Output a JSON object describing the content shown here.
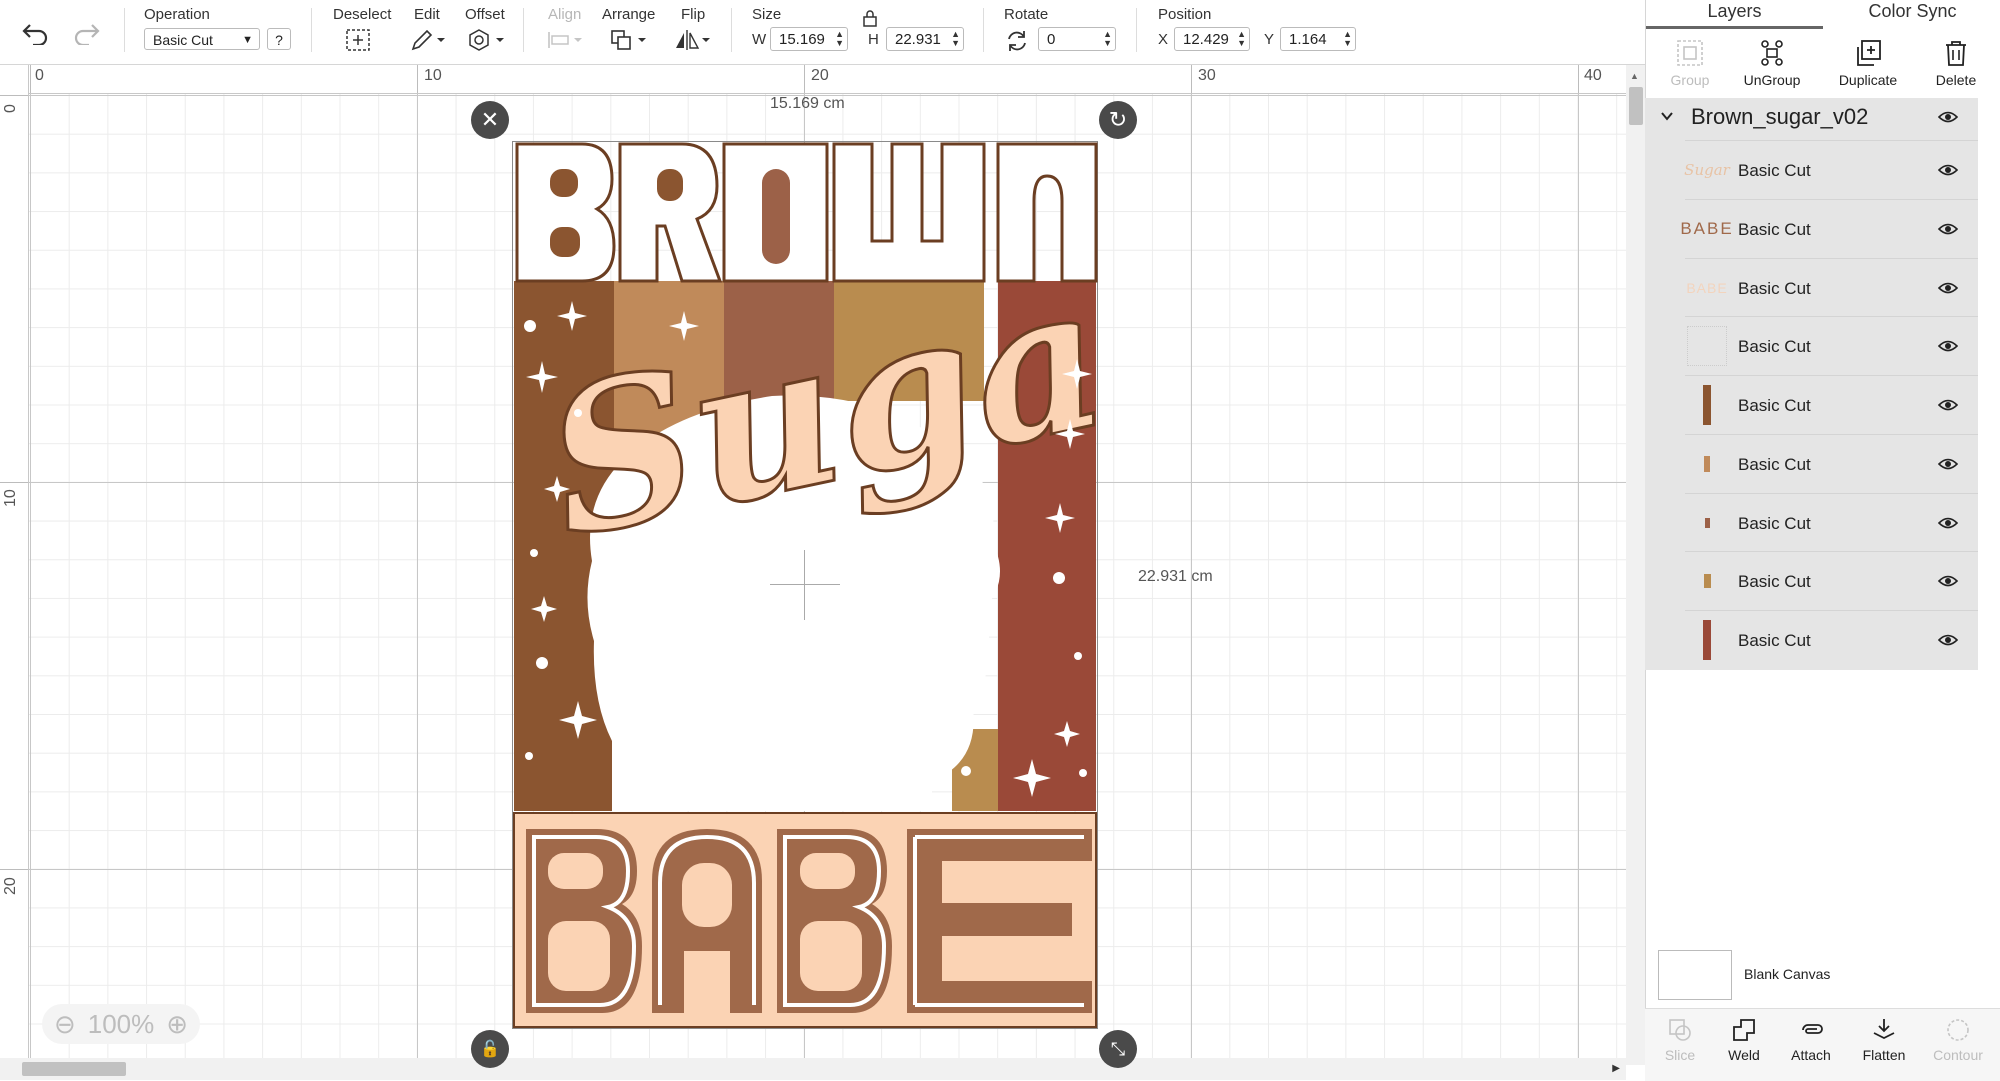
{
  "toolbar": {
    "operation": {
      "label": "Operation",
      "value": "Basic Cut",
      "help": "?"
    },
    "deselect": {
      "label": "Deselect"
    },
    "edit": {
      "label": "Edit"
    },
    "offset": {
      "label": "Offset"
    },
    "align": {
      "label": "Align"
    },
    "arrange": {
      "label": "Arrange"
    },
    "flip": {
      "label": "Flip"
    },
    "size": {
      "label": "Size",
      "w_label": "W",
      "w_value": "15.169",
      "h_label": "H",
      "h_value": "22.931"
    },
    "rotate": {
      "label": "Rotate",
      "value": "0"
    },
    "position": {
      "label": "Position",
      "x_label": "X",
      "x_value": "12.429",
      "y_label": "Y",
      "y_value": "1.164"
    }
  },
  "ruler": {
    "top": [
      "0",
      "10",
      "20",
      "30",
      "40"
    ],
    "left": [
      "0",
      "10",
      "20"
    ]
  },
  "canvas": {
    "width_label": "15.169 cm",
    "height_label": "22.931 cm",
    "zoom": "100%"
  },
  "design": {
    "word_top": "BROWN",
    "word_middle": "Sugar",
    "word_bottom": "BABE",
    "colors": {
      "dark_brown": "#8b5530",
      "caramel": "#c08a5a",
      "mocha": "#9c6148",
      "gold": "#b98c4f",
      "rust": "#9a4938",
      "peach": "#fbd3b4",
      "mid_brown": "#a0694a"
    }
  },
  "panel": {
    "tabs": [
      "Layers",
      "Color Sync"
    ],
    "actions": [
      "Group",
      "UnGroup",
      "Duplicate",
      "Delete"
    ],
    "group_name": "Brown_sugar_v02",
    "layers": [
      {
        "name": "Basic Cut",
        "thumb": "Sugar"
      },
      {
        "name": "Basic Cut",
        "thumb": "BABE"
      },
      {
        "name": "Basic Cut",
        "thumb": "BABE"
      },
      {
        "name": "Basic Cut",
        "thumb": ""
      },
      {
        "name": "Basic Cut",
        "thumb": ""
      },
      {
        "name": "Basic Cut",
        "thumb": ""
      },
      {
        "name": "Basic Cut",
        "thumb": ""
      },
      {
        "name": "Basic Cut",
        "thumb": ""
      },
      {
        "name": "Basic Cut",
        "thumb": ""
      }
    ],
    "blank_canvas": "Blank Canvas",
    "bottom_tools": [
      "Slice",
      "Weld",
      "Attach",
      "Flatten",
      "Contour"
    ]
  }
}
